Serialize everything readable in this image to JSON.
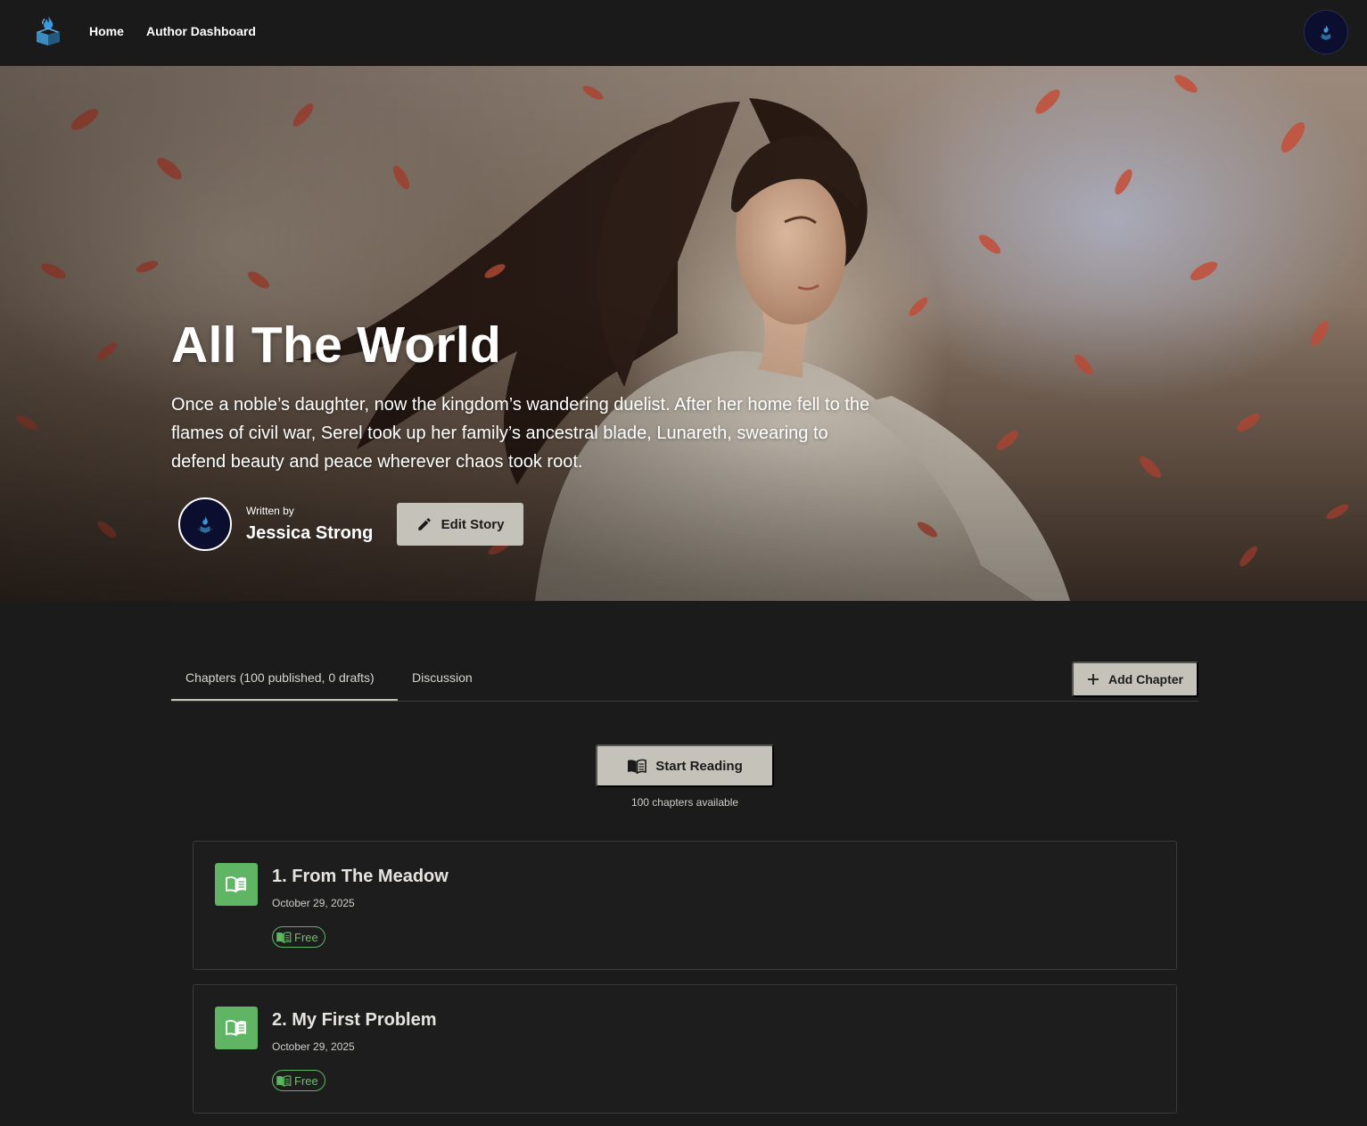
{
  "nav": {
    "home": "Home",
    "author_dashboard": "Author Dashboard",
    "logo_icon": "book-flame-logo-icon",
    "avatar_icon": "user-avatar-icon"
  },
  "story": {
    "title": "All The World",
    "description": "Once a noble’s daughter, now the kingdom’s wandering duelist. After her home fell to the flames of civil war, Serel took up her family’s ancestral blade, Lunareth, swearing to defend beauty and peace wherever chaos took root.",
    "written_by_label": "Written by",
    "author": "Jessica Strong",
    "edit_label": "Edit Story"
  },
  "tabs": [
    {
      "label": "Chapters (100 published, 0 drafts)",
      "active": true
    },
    {
      "label": "Discussion",
      "active": false
    }
  ],
  "add_chapter_label": "Add Chapter",
  "reading": {
    "start_label": "Start Reading",
    "available": "100 chapters available"
  },
  "chapters": [
    {
      "title": "1. From The Meadow",
      "date": "October 29, 2025",
      "badge": "Free"
    },
    {
      "title": "2. My First Problem",
      "date": "October 29, 2025",
      "badge": "Free"
    }
  ],
  "colors": {
    "background": "#1b1b1b",
    "button": "#c5c3b9",
    "accent_green": "#5fb563"
  }
}
